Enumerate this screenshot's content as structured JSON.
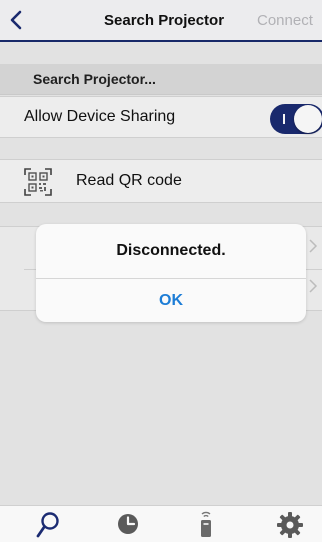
{
  "header": {
    "title": "Search Projector",
    "next_label": "Connect",
    "back_icon": "chevron-left-icon"
  },
  "section": {
    "title": "Search Projector..."
  },
  "sharing": {
    "label": "Allow Device Sharing",
    "enabled": true
  },
  "qr": {
    "label": "Read QR code",
    "icon": "qr-code-icon"
  },
  "dialog": {
    "message": "Disconnected.",
    "ok_label": "OK"
  },
  "tabbar": {
    "items": [
      {
        "icon": "search-icon",
        "selected": true
      },
      {
        "icon": "history-icon",
        "selected": false
      },
      {
        "icon": "remote-icon",
        "selected": false
      },
      {
        "icon": "settings-icon",
        "selected": false
      }
    ]
  },
  "colors": {
    "accent": "#1b2b72",
    "link": "#1d7dd6"
  }
}
